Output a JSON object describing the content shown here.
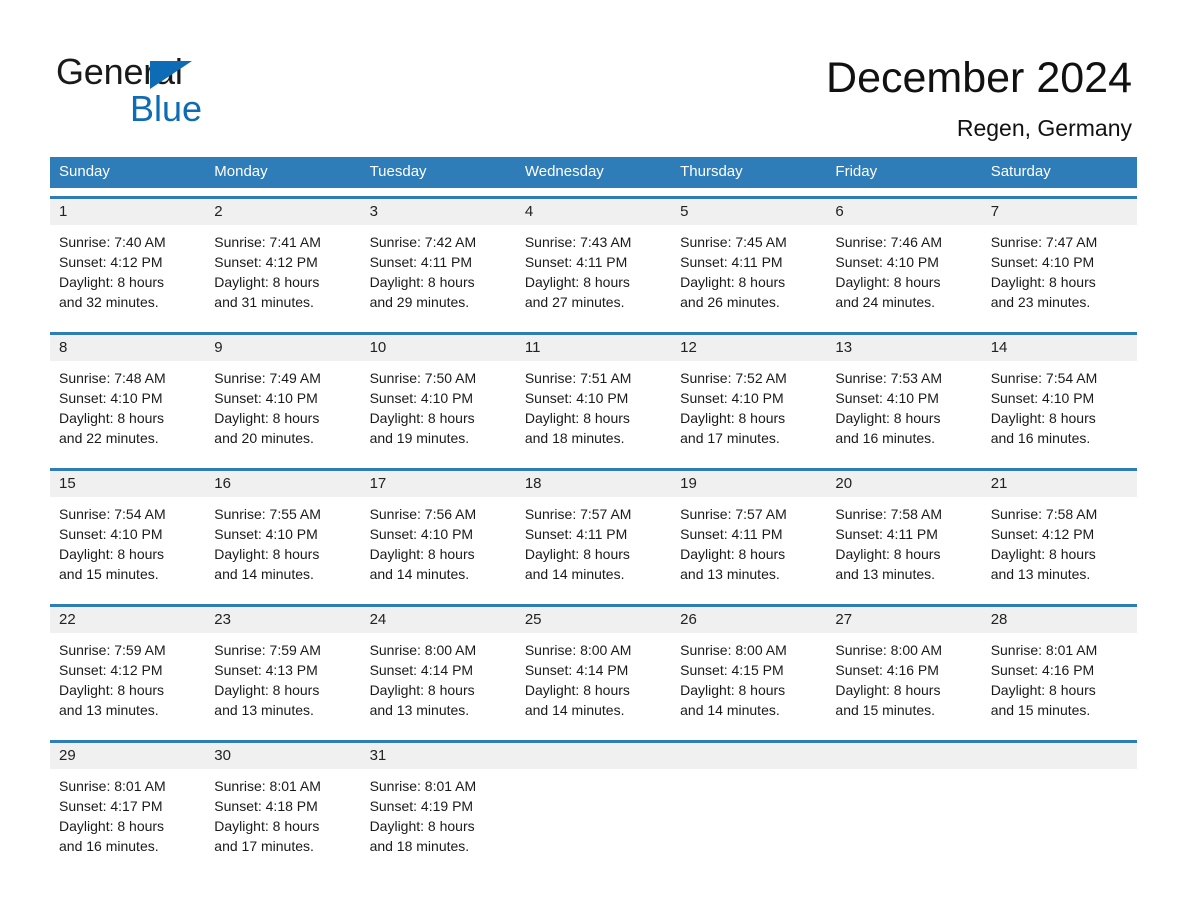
{
  "brand": {
    "name_part1": "General",
    "name_part2": "Blue",
    "accent_color": "#0d6cb5",
    "triangle_icon": "brand-triangle-icon"
  },
  "header": {
    "title": "December 2024",
    "subtitle": "Regen, Germany"
  },
  "calendar": {
    "header_bg": "#2e7cb8",
    "header_text_color": "#ffffff",
    "daynum_band_bg": "#f0f0f0",
    "weekdays": [
      "Sunday",
      "Monday",
      "Tuesday",
      "Wednesday",
      "Thursday",
      "Friday",
      "Saturday"
    ],
    "weeks": [
      [
        {
          "day": "1",
          "sunrise": "Sunrise: 7:40 AM",
          "sunset": "Sunset: 4:12 PM",
          "daylight_l1": "Daylight: 8 hours",
          "daylight_l2": "and 32 minutes."
        },
        {
          "day": "2",
          "sunrise": "Sunrise: 7:41 AM",
          "sunset": "Sunset: 4:12 PM",
          "daylight_l1": "Daylight: 8 hours",
          "daylight_l2": "and 31 minutes."
        },
        {
          "day": "3",
          "sunrise": "Sunrise: 7:42 AM",
          "sunset": "Sunset: 4:11 PM",
          "daylight_l1": "Daylight: 8 hours",
          "daylight_l2": "and 29 minutes."
        },
        {
          "day": "4",
          "sunrise": "Sunrise: 7:43 AM",
          "sunset": "Sunset: 4:11 PM",
          "daylight_l1": "Daylight: 8 hours",
          "daylight_l2": "and 27 minutes."
        },
        {
          "day": "5",
          "sunrise": "Sunrise: 7:45 AM",
          "sunset": "Sunset: 4:11 PM",
          "daylight_l1": "Daylight: 8 hours",
          "daylight_l2": "and 26 minutes."
        },
        {
          "day": "6",
          "sunrise": "Sunrise: 7:46 AM",
          "sunset": "Sunset: 4:10 PM",
          "daylight_l1": "Daylight: 8 hours",
          "daylight_l2": "and 24 minutes."
        },
        {
          "day": "7",
          "sunrise": "Sunrise: 7:47 AM",
          "sunset": "Sunset: 4:10 PM",
          "daylight_l1": "Daylight: 8 hours",
          "daylight_l2": "and 23 minutes."
        }
      ],
      [
        {
          "day": "8",
          "sunrise": "Sunrise: 7:48 AM",
          "sunset": "Sunset: 4:10 PM",
          "daylight_l1": "Daylight: 8 hours",
          "daylight_l2": "and 22 minutes."
        },
        {
          "day": "9",
          "sunrise": "Sunrise: 7:49 AM",
          "sunset": "Sunset: 4:10 PM",
          "daylight_l1": "Daylight: 8 hours",
          "daylight_l2": "and 20 minutes."
        },
        {
          "day": "10",
          "sunrise": "Sunrise: 7:50 AM",
          "sunset": "Sunset: 4:10 PM",
          "daylight_l1": "Daylight: 8 hours",
          "daylight_l2": "and 19 minutes."
        },
        {
          "day": "11",
          "sunrise": "Sunrise: 7:51 AM",
          "sunset": "Sunset: 4:10 PM",
          "daylight_l1": "Daylight: 8 hours",
          "daylight_l2": "and 18 minutes."
        },
        {
          "day": "12",
          "sunrise": "Sunrise: 7:52 AM",
          "sunset": "Sunset: 4:10 PM",
          "daylight_l1": "Daylight: 8 hours",
          "daylight_l2": "and 17 minutes."
        },
        {
          "day": "13",
          "sunrise": "Sunrise: 7:53 AM",
          "sunset": "Sunset: 4:10 PM",
          "daylight_l1": "Daylight: 8 hours",
          "daylight_l2": "and 16 minutes."
        },
        {
          "day": "14",
          "sunrise": "Sunrise: 7:54 AM",
          "sunset": "Sunset: 4:10 PM",
          "daylight_l1": "Daylight: 8 hours",
          "daylight_l2": "and 16 minutes."
        }
      ],
      [
        {
          "day": "15",
          "sunrise": "Sunrise: 7:54 AM",
          "sunset": "Sunset: 4:10 PM",
          "daylight_l1": "Daylight: 8 hours",
          "daylight_l2": "and 15 minutes."
        },
        {
          "day": "16",
          "sunrise": "Sunrise: 7:55 AM",
          "sunset": "Sunset: 4:10 PM",
          "daylight_l1": "Daylight: 8 hours",
          "daylight_l2": "and 14 minutes."
        },
        {
          "day": "17",
          "sunrise": "Sunrise: 7:56 AM",
          "sunset": "Sunset: 4:10 PM",
          "daylight_l1": "Daylight: 8 hours",
          "daylight_l2": "and 14 minutes."
        },
        {
          "day": "18",
          "sunrise": "Sunrise: 7:57 AM",
          "sunset": "Sunset: 4:11 PM",
          "daylight_l1": "Daylight: 8 hours",
          "daylight_l2": "and 14 minutes."
        },
        {
          "day": "19",
          "sunrise": "Sunrise: 7:57 AM",
          "sunset": "Sunset: 4:11 PM",
          "daylight_l1": "Daylight: 8 hours",
          "daylight_l2": "and 13 minutes."
        },
        {
          "day": "20",
          "sunrise": "Sunrise: 7:58 AM",
          "sunset": "Sunset: 4:11 PM",
          "daylight_l1": "Daylight: 8 hours",
          "daylight_l2": "and 13 minutes."
        },
        {
          "day": "21",
          "sunrise": "Sunrise: 7:58 AM",
          "sunset": "Sunset: 4:12 PM",
          "daylight_l1": "Daylight: 8 hours",
          "daylight_l2": "and 13 minutes."
        }
      ],
      [
        {
          "day": "22",
          "sunrise": "Sunrise: 7:59 AM",
          "sunset": "Sunset: 4:12 PM",
          "daylight_l1": "Daylight: 8 hours",
          "daylight_l2": "and 13 minutes."
        },
        {
          "day": "23",
          "sunrise": "Sunrise: 7:59 AM",
          "sunset": "Sunset: 4:13 PM",
          "daylight_l1": "Daylight: 8 hours",
          "daylight_l2": "and 13 minutes."
        },
        {
          "day": "24",
          "sunrise": "Sunrise: 8:00 AM",
          "sunset": "Sunset: 4:14 PM",
          "daylight_l1": "Daylight: 8 hours",
          "daylight_l2": "and 13 minutes."
        },
        {
          "day": "25",
          "sunrise": "Sunrise: 8:00 AM",
          "sunset": "Sunset: 4:14 PM",
          "daylight_l1": "Daylight: 8 hours",
          "daylight_l2": "and 14 minutes."
        },
        {
          "day": "26",
          "sunrise": "Sunrise: 8:00 AM",
          "sunset": "Sunset: 4:15 PM",
          "daylight_l1": "Daylight: 8 hours",
          "daylight_l2": "and 14 minutes."
        },
        {
          "day": "27",
          "sunrise": "Sunrise: 8:00 AM",
          "sunset": "Sunset: 4:16 PM",
          "daylight_l1": "Daylight: 8 hours",
          "daylight_l2": "and 15 minutes."
        },
        {
          "day": "28",
          "sunrise": "Sunrise: 8:01 AM",
          "sunset": "Sunset: 4:16 PM",
          "daylight_l1": "Daylight: 8 hours",
          "daylight_l2": "and 15 minutes."
        }
      ],
      [
        {
          "day": "29",
          "sunrise": "Sunrise: 8:01 AM",
          "sunset": "Sunset: 4:17 PM",
          "daylight_l1": "Daylight: 8 hours",
          "daylight_l2": "and 16 minutes."
        },
        {
          "day": "30",
          "sunrise": "Sunrise: 8:01 AM",
          "sunset": "Sunset: 4:18 PM",
          "daylight_l1": "Daylight: 8 hours",
          "daylight_l2": "and 17 minutes."
        },
        {
          "day": "31",
          "sunrise": "Sunrise: 8:01 AM",
          "sunset": "Sunset: 4:19 PM",
          "daylight_l1": "Daylight: 8 hours",
          "daylight_l2": "and 18 minutes."
        },
        {
          "day": "",
          "sunrise": "",
          "sunset": "",
          "daylight_l1": "",
          "daylight_l2": ""
        },
        {
          "day": "",
          "sunrise": "",
          "sunset": "",
          "daylight_l1": "",
          "daylight_l2": ""
        },
        {
          "day": "",
          "sunrise": "",
          "sunset": "",
          "daylight_l1": "",
          "daylight_l2": ""
        },
        {
          "day": "",
          "sunrise": "",
          "sunset": "",
          "daylight_l1": "",
          "daylight_l2": ""
        }
      ]
    ]
  }
}
